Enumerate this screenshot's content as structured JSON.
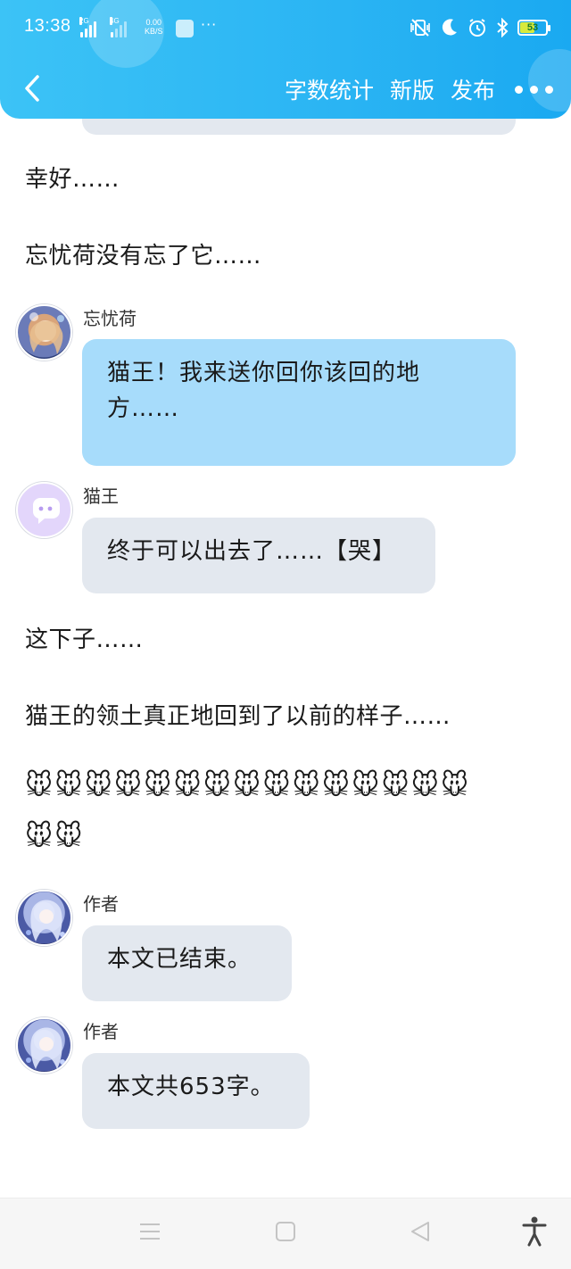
{
  "status_bar": {
    "time": "13:38",
    "net1": "2G",
    "net2": "4G",
    "speed_value": "0.00",
    "speed_unit": "KB/S",
    "extra": "···",
    "battery": "53"
  },
  "nav": {
    "actions": [
      "字数统计",
      "新版",
      "发布"
    ]
  },
  "narration": [
    "幸好……",
    "忘忧荷没有忘了它……",
    "这下子……",
    "猫王的领土真正地回到了以前的样子……"
  ],
  "messages": [
    {
      "speaker": "忘忧荷",
      "text_line1": "猫王！我来送你回你该回的地",
      "text_line2": "方……"
    },
    {
      "speaker": "猫王",
      "text": "终于可以出去了……【哭】"
    },
    {
      "speaker": "作者",
      "text": "本文已结束。"
    },
    {
      "speaker": "作者",
      "text": "本文共653字。"
    }
  ],
  "emoji": {
    "row1": "🐭🐭🐭🐭🐭🐭🐭🐭🐭🐭🐭🐭🐭🐭🐭",
    "row2": "🐭🐭"
  },
  "colors": {
    "header": "#2ab4f3",
    "bubble_blue": "#a7dcfb",
    "bubble_gray": "#e3e8ef"
  }
}
